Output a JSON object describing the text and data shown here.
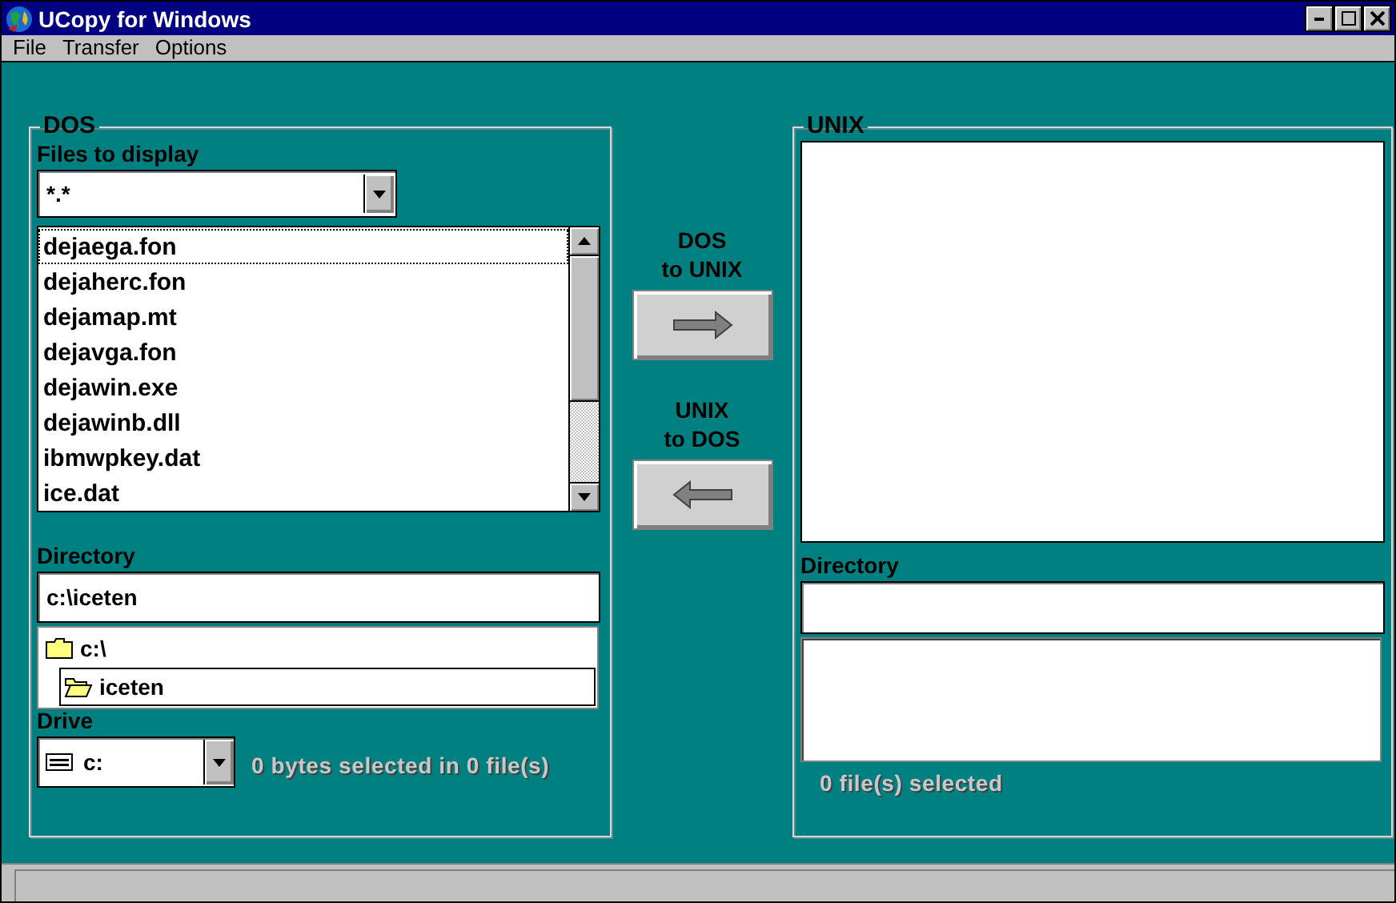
{
  "window": {
    "title": "UCopy for Windows"
  },
  "menu": [
    {
      "label": "File"
    },
    {
      "label": "Transfer"
    },
    {
      "label": "Options"
    }
  ],
  "dos": {
    "legend": "DOS",
    "files_label": "Files to display",
    "filter": "*.*",
    "files": [
      {
        "name": "dejaega.fon",
        "focused": true
      },
      {
        "name": "dejaherc.fon",
        "focused": false
      },
      {
        "name": "dejamap.mt",
        "focused": false
      },
      {
        "name": "dejavga.fon",
        "focused": false
      },
      {
        "name": "dejawin.exe",
        "focused": false
      },
      {
        "name": "dejawinb.dll",
        "focused": false
      },
      {
        "name": "ibmwpkey.dat",
        "focused": false
      },
      {
        "name": "ice.dat",
        "focused": false
      }
    ],
    "directory_label": "Directory",
    "directory": "c:\\iceten",
    "folders": [
      {
        "name": "c:\\",
        "selected": false,
        "children": [
          {
            "name": "iceten",
            "selected": true
          }
        ]
      }
    ],
    "drive_label": "Drive",
    "drive": "c:",
    "status": "0 bytes selected in 0 file(s)"
  },
  "transfer": [
    {
      "lines": [
        "DOS",
        "to UNIX"
      ],
      "kind": "right"
    },
    {
      "lines": [
        "UNIX",
        "to DOS"
      ],
      "kind": "left"
    }
  ],
  "unix": {
    "legend": "UNIX",
    "directory_label": "Directory",
    "status": "0 file(s) selected"
  }
}
